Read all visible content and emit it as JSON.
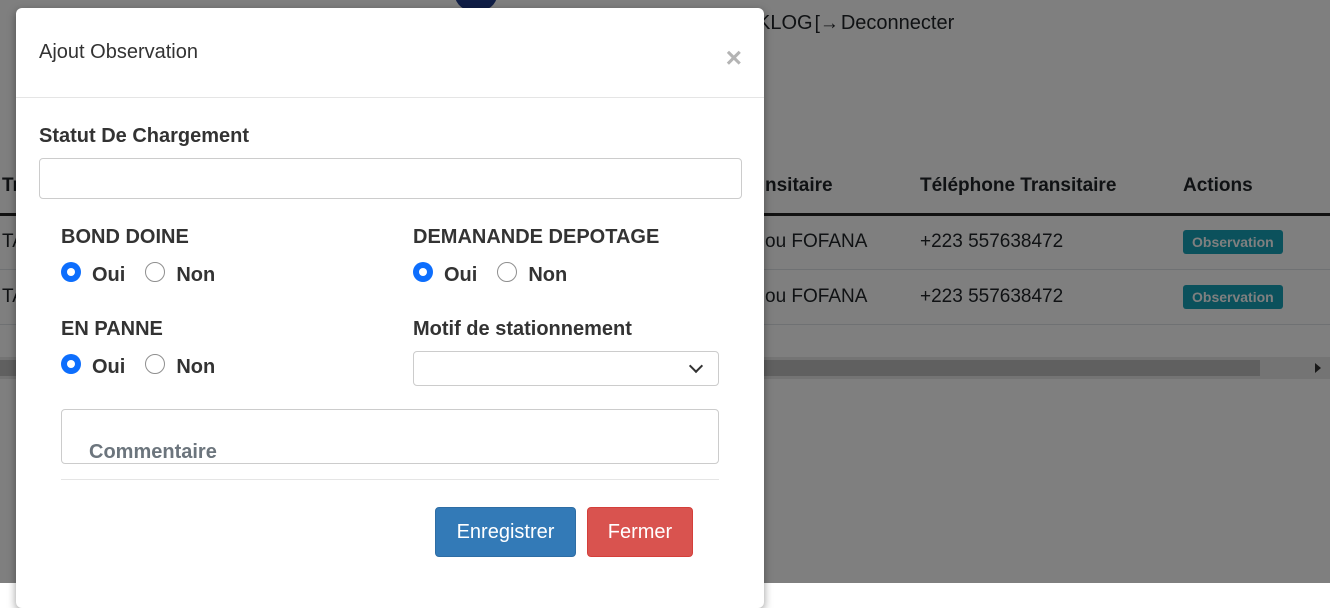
{
  "background": {
    "top_user_text": "KLOG",
    "logout_label": "Deconnecter",
    "table": {
      "headers": [
        "Tr",
        "nsitaire",
        "Téléphone Transitaire",
        "Actions"
      ],
      "rows": [
        {
          "col1": "TA",
          "col2": "ou FOFANA",
          "phone": "+223 557638472",
          "action": "Observation"
        },
        {
          "col1": "TA",
          "col2": "ou FOFANA",
          "phone": "+223 557638472",
          "action": "Observation"
        }
      ]
    }
  },
  "modal": {
    "title": "Ajout Observation",
    "close_symbol": "×",
    "statut_label": "Statut De Chargement",
    "statut_value": "",
    "bond_doine": {
      "label": "BOND DOINE",
      "yes": "Oui",
      "no": "Non",
      "selected": "Oui"
    },
    "demande_depotage": {
      "label": "DEMANANDE DEPOTAGE",
      "yes": "Oui",
      "no": "Non",
      "selected": "Oui"
    },
    "en_panne": {
      "label": "EN PANNE",
      "yes": "Oui",
      "no": "Non",
      "selected": "Oui"
    },
    "motif": {
      "label": "Motif de stationnement",
      "value": ""
    },
    "comment_placeholder": "Commentaire",
    "save_label": "Enregistrer",
    "close_label": "Fermer"
  },
  "colors": {
    "primary": "#337ab7",
    "danger": "#d9534f",
    "radio_checked": "#0d6efd",
    "badge": "#17a2b8"
  }
}
